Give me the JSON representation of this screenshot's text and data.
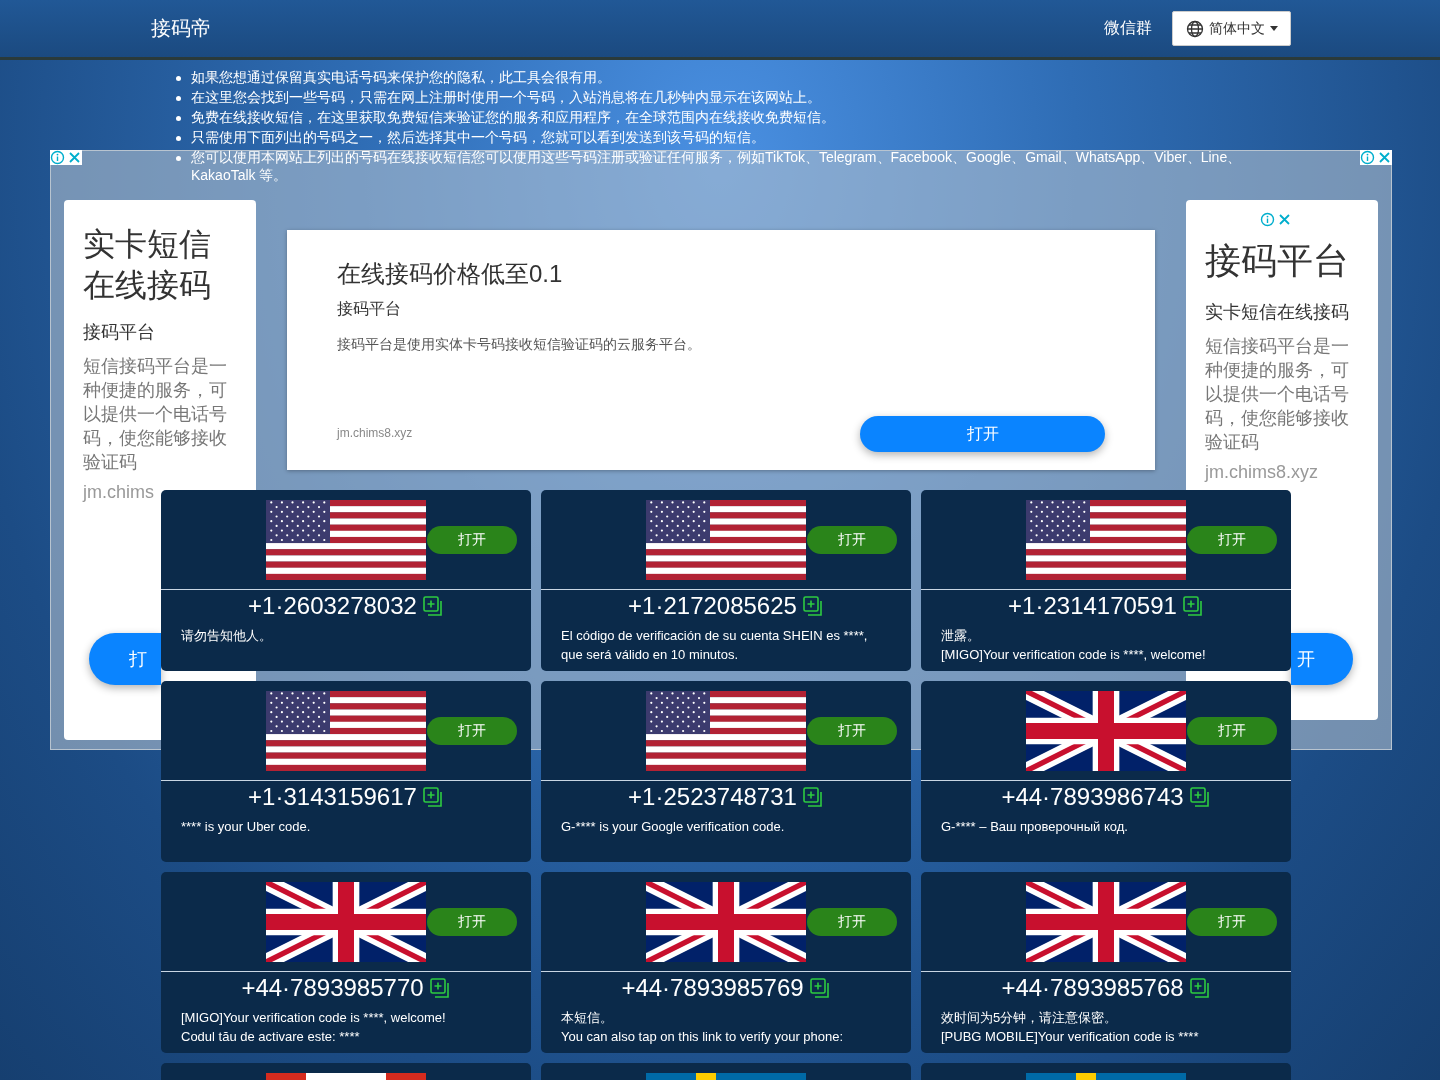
{
  "header": {
    "brand": "接码帝",
    "links": [
      "微信群"
    ],
    "language_button": "简体中文"
  },
  "intro": [
    "如果您想通过保留真实电话号码来保护您的隐私，此工具会很有用。",
    "在这里您会找到一些号码，只需在网上注册时使用一个号码，入站消息将在几秒钟内显示在该网站上。",
    "免费在线接收短信，在这里获取免费短信来验证您的服务和应用程序，在全球范围内在线接收免费短信。",
    "只需使用下面列出的号码之一，然后选择其中一个号码，您就可以看到发送到该号码的短信。",
    "您可以使用本网站上列出的号码在线接收短信您可以使用这些号码注册或验证任何服务，例如TikTok、Telegram、Facebook、Google、Gmail、WhatsApp、Viber、Line、KakaoTalk 等。"
  ],
  "ads": {
    "left": {
      "title": "实卡短信在线接码",
      "subtitle": "接码平台",
      "description": "短信接码平台是一种便捷的服务，可以提供一个电话号码，使您能够接收验证码",
      "url": "jm.chims",
      "button": "打"
    },
    "center": {
      "title": "在线接码价格低至0.1",
      "subtitle": "接码平台",
      "description": "接码平台是使用实体卡号码接收短信验证码的云服务平台。",
      "url": "jm.chims8.xyz",
      "button": "打开"
    },
    "right": {
      "title": "接码平台",
      "subtitle": "实卡短信在线接码",
      "description": "短信接码平台是一种便捷的服务，可以提供一个电话号码，使您能够接收验证码",
      "url": "jm.chims8.xyz",
      "button": "开"
    }
  },
  "numbers": [
    {
      "kind": "us",
      "number": "+1·2603278032",
      "messages": [
        "请勿告知他人。"
      ],
      "button": "打开"
    },
    {
      "kind": "us",
      "number": "+1·2172085625",
      "messages": [
        "El código de verificación de su cuenta SHEIN es ****, que será válido en 10 minutos."
      ],
      "button": "打开"
    },
    {
      "kind": "us",
      "number": "+1·2314170591",
      "messages": [
        "泄露。",
        "[MIGO]Your verification code is ****, welcome!"
      ],
      "button": "打开"
    },
    {
      "kind": "us",
      "number": "+1·3143159617",
      "messages": [
        "**** is your Uber code."
      ],
      "button": "打开"
    },
    {
      "kind": "us",
      "number": "+1·2523748731",
      "messages": [
        "G-**** is your Google verification code."
      ],
      "button": "打开"
    },
    {
      "kind": "gb",
      "number": "+44·7893986743",
      "messages": [
        "G-**** – Ваш проверочный код."
      ],
      "button": "打开"
    },
    {
      "kind": "gb",
      "number": "+44·7893985770",
      "messages": [
        "[MIGO]Your verification code is ****, welcome!",
        "Codul tău de activare este: ****"
      ],
      "button": "打开"
    },
    {
      "kind": "gb",
      "number": "+44·7893985769",
      "messages": [
        "本短信。",
        "You can also tap on this link to verify your phone:"
      ],
      "button": "打开"
    },
    {
      "kind": "gb",
      "number": "+44·7893985768",
      "messages": [
        "效时间为5分钟，请注意保密。",
        "[PUBG MOBILE]Your verification code is ****"
      ],
      "button": "打开"
    },
    {
      "kind": "ca"
    },
    {
      "kind": "se"
    },
    {
      "kind": "se"
    }
  ]
}
